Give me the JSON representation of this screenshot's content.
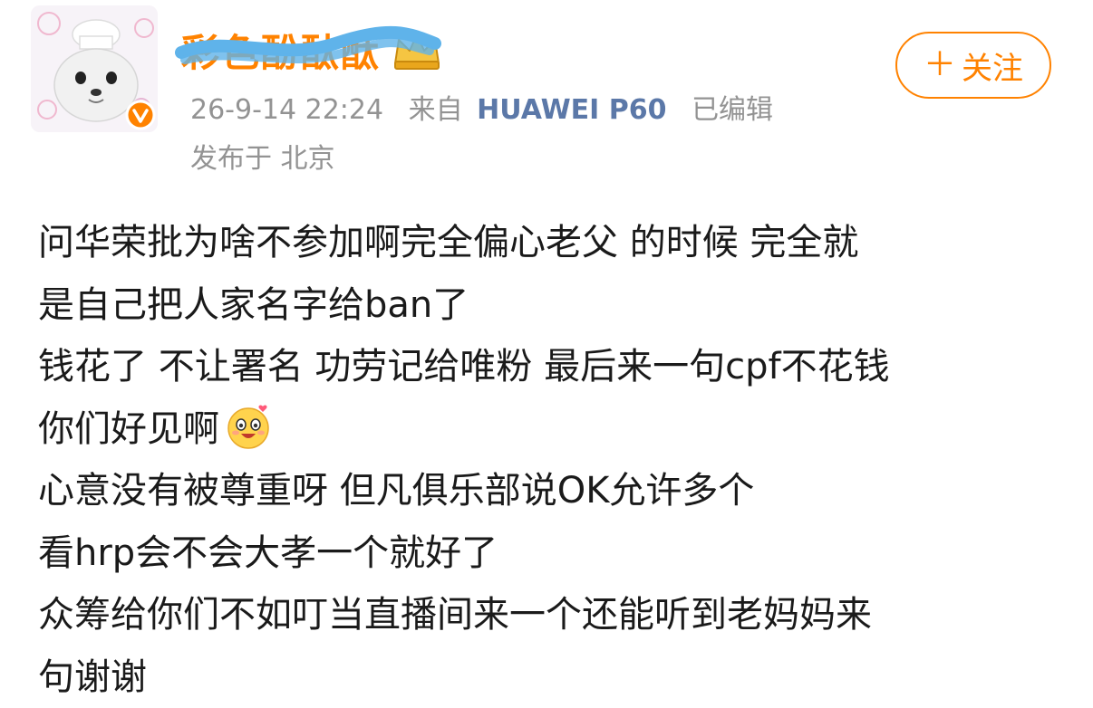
{
  "post": {
    "username": "彩色酚酞酞",
    "timestamp": "26-9-14 22:24",
    "source_prefix": "来自",
    "device": "HUAWEI P60",
    "edited": "已编辑",
    "location": "发布于 北京",
    "follow_label": "关注",
    "follow_icon": "plus-icon",
    "accent_color": "#ff8200",
    "content_lines": [
      "问华荣批为啥不参加啊完全偏心老父 的时候   完全就",
      "是自己把人家名字给ban了",
      "钱花了 不让署名 功劳记给唯粉 最后来一句cpf不花钱",
      "你们好见啊",
      "心意没有被尊重呀  但凡俱乐部说OK允许多个",
      "看hrp会不会大孝一个就好了",
      "众筹给你们不如叮当直播间来一个还能听到老妈妈来",
      "句谢谢"
    ]
  }
}
